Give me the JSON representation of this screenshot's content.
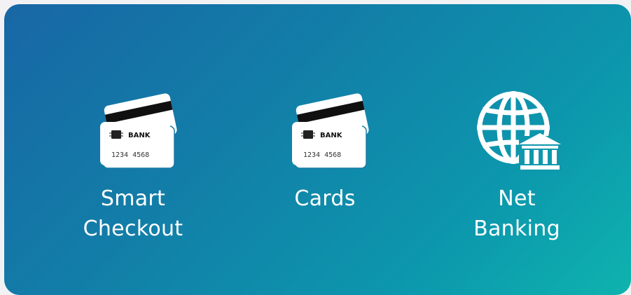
{
  "payment_options": [
    {
      "label_line1": "Smart",
      "label_line2": "Checkout",
      "icon": "credit-card-icon",
      "card_bank": "BANK",
      "card_number": "1234 4568"
    },
    {
      "label_line1": "Cards",
      "label_line2": "",
      "icon": "credit-card-icon",
      "card_bank": "BANK",
      "card_number": "1234 4568"
    },
    {
      "label_line1": "Net",
      "label_line2": "Banking",
      "icon": "globe-bank-icon"
    }
  ],
  "colors": {
    "gradient_start": "#1867a5",
    "gradient_end": "#0eb3ae",
    "text": "#ffffff"
  }
}
